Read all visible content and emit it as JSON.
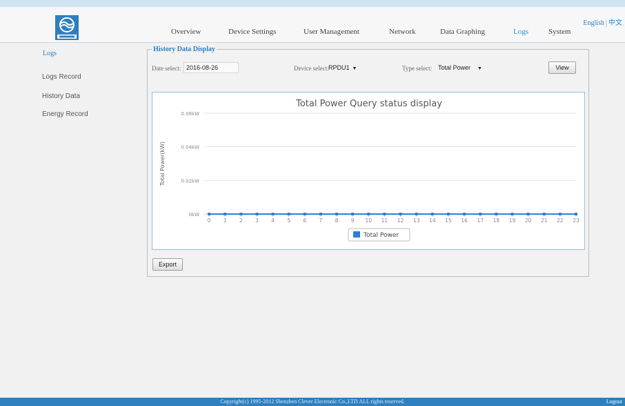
{
  "header": {
    "language_links": [
      "English",
      "中文"
    ],
    "nav": [
      {
        "label": "Overview",
        "active": false
      },
      {
        "label": "Device Settings",
        "active": false
      },
      {
        "label": "User Management",
        "active": false
      },
      {
        "label": "Network",
        "active": false
      },
      {
        "label": "Data Graphing",
        "active": false
      },
      {
        "label": "Logs",
        "active": true
      },
      {
        "label": "System",
        "active": false
      }
    ]
  },
  "sidebar": {
    "title": "Logs",
    "items": [
      "Logs Record",
      "History Data",
      "Energy Record"
    ]
  },
  "panel": {
    "title": "History Data Display",
    "date_label": "Date select:",
    "date_value": "2016-08-26",
    "device_label": "Device select:",
    "device_value": "RPDU1",
    "type_label": "Type select:",
    "type_value": "Total Power",
    "view_button": "View",
    "export_button": "Export"
  },
  "chart_data": {
    "type": "line",
    "title": "Total Power Query status display",
    "ylabel": "Total Power(kW)",
    "xlabel": "",
    "y_ticks": [
      "0kW",
      "0.02kW",
      "0.04kW",
      "0.06kW"
    ],
    "ylim": [
      0,
      0.06
    ],
    "x": [
      0,
      1,
      2,
      3,
      4,
      5,
      6,
      7,
      8,
      9,
      10,
      11,
      12,
      13,
      14,
      15,
      16,
      17,
      18,
      19,
      20,
      21,
      22,
      23
    ],
    "series": [
      {
        "name": "Total Power",
        "color": "#2f7ed8",
        "values": [
          0,
          0,
          0,
          0,
          0,
          0,
          0,
          0,
          0,
          0,
          0,
          0,
          0,
          0,
          0,
          0,
          0,
          0,
          0,
          0,
          0,
          0,
          0,
          0
        ]
      }
    ],
    "grid": true,
    "legend": "bottom-center"
  },
  "footer": {
    "copyright": "Copyright(c) 1995-2012 Shenzhen Clever Electronic Co.,LTD ALL rights reserved.",
    "logout": "Logout"
  },
  "colors": {
    "accent": "#2d7fc0",
    "footer": "#2e7fbe",
    "series": "#2f7ed8"
  }
}
